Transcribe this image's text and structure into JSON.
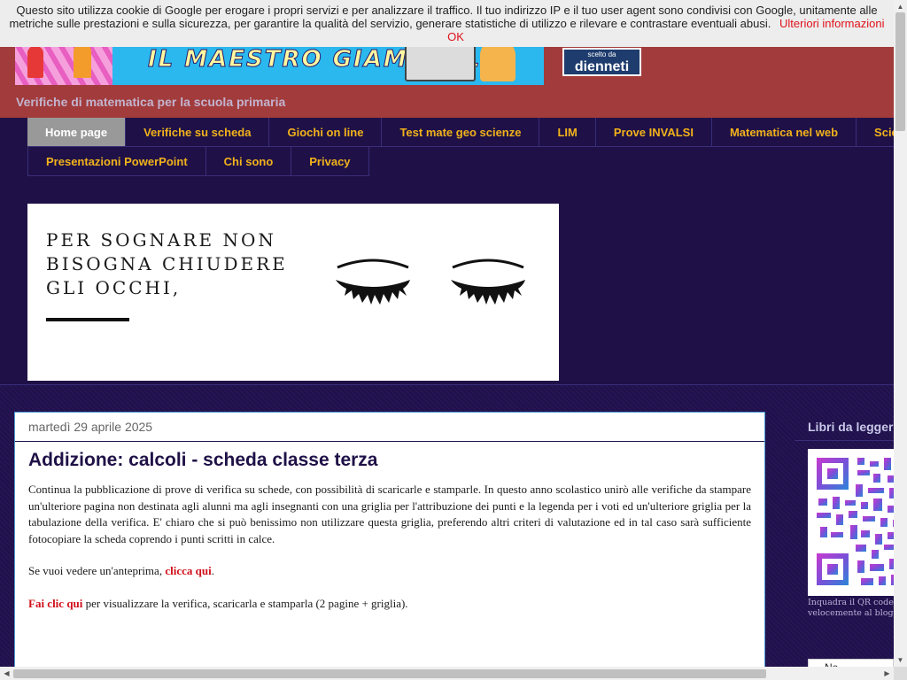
{
  "cookie_bar": {
    "text": "Questo sito utilizza cookie di Google per erogare i propri servizi e per analizzare il traffico. Il tuo indirizzo IP e il tuo user agent sono condivisi con Google, unitamente alle metriche sulle prestazioni e sulla sicurezza, per garantire la qualità del servizio, generare statistiche di utilizzo e rilevare e contrastare eventuali abusi.",
    "more_link": "Ulteriori informazioni",
    "ok_link": "OK"
  },
  "header": {
    "banner_title": "IL MAESTRO GIAMPAOLO",
    "badge_small": "scelto da",
    "badge_brand": "dienneti",
    "description": "Verifiche di matematica per la scuola primaria"
  },
  "nav": {
    "row1": [
      "Home page",
      "Verifiche su scheda",
      "Giochi on line",
      "Test mate geo scienze",
      "LIM",
      "Prove INVALSI",
      "Matematica nel web",
      "Scienze"
    ],
    "row2": [
      "Presentazioni PowerPoint",
      "Chi sono",
      "Privacy"
    ],
    "active": "Home page"
  },
  "quote": {
    "text": "PER SOGNARE NON BISOGNA CHIUDERE GLI OCCHI,"
  },
  "post": {
    "date": "martedì 29 aprile 2025",
    "title": "Addizione: calcoli - scheda classe terza",
    "paragraph1": "Continua la pubblicazione di prove di verifica su schede, con possibilità di scaricarle e stamparle. In questo anno scolastico unirò alle verifiche da stampare un'ulteriore pagina non destinata agli alunni ma agli insegnanti con una griglia per l'attribuzione dei punti e la legenda per i voti ed un'ulteriore griglia per la tabulazione della verifica. E' chiaro che si può benissimo non utilizzare questa griglia, preferendo altri criteri di valutazione ed in tal caso sarà sufficiente fotocopiare la scheda coprendo i punti scritti in calce.",
    "p2_prefix": "Se vuoi vedere un'anteprima, ",
    "p2_link": "clicca qui",
    "p2_suffix": ".",
    "p3_link": "Fai clic qui",
    "p3_suffix": " per visualizzare la verifica, scaricarla e stamparla (2 pagine + griglia)."
  },
  "sidebar": {
    "title": "Libri da leggere",
    "qr_caption_1": "Inquadra il QR code",
    "qr_caption_2": "velocemente al blog",
    "widget_text": "Ne ..."
  },
  "colors": {
    "page_bg": "#1f1147",
    "header_bg": "#a23b3b",
    "nav_text": "#f2b21b",
    "nav_active_bg": "#999999",
    "link_red": "#d0101a"
  }
}
